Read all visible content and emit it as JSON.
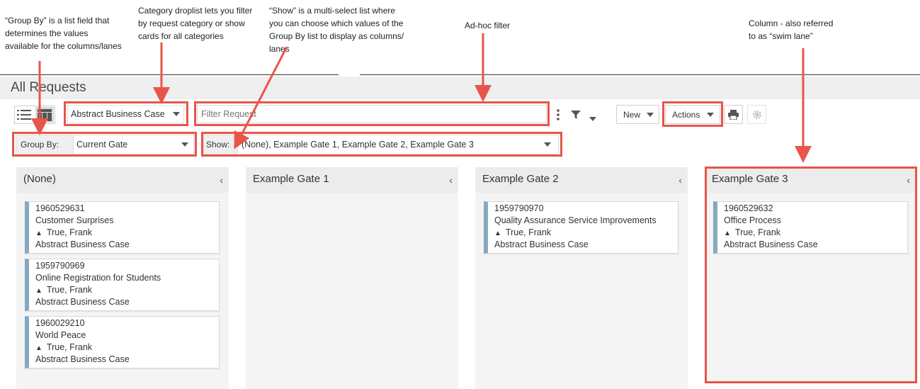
{
  "annotations": {
    "group_by": "“Group By” is a list field that\ndetermines the values\navailable for the columns/lanes",
    "category": "Category droplist lets you filter\nby request category or show\ncards for all categories",
    "show": "“Show” is a multi-select list where\nyou can choose which values of the\nGroup By list to display as columns/\nlanes",
    "adhoc": "Ad-hoc filter",
    "column": "Column - also referred\nto as “swim lane”"
  },
  "page": {
    "title": "All Requests"
  },
  "toolbar": {
    "category_value": "Abstract Business Case",
    "filter_placeholder": "Filter Request",
    "new_label": "New",
    "actions_label": "Actions"
  },
  "controls": {
    "group_by_label": "Group By:",
    "group_by_value": "Current Gate",
    "show_label": "Show:",
    "show_value": "(None), Example Gate 1, Example Gate 2, Example Gate 3"
  },
  "lanes": [
    {
      "title": "(None)",
      "cards": [
        {
          "id": "1960529631",
          "name": "Customer Surprises",
          "owner": "True, Frank",
          "category": "Abstract Business Case"
        },
        {
          "id": "1959790969",
          "name": "Online Registration for Students",
          "owner": "True, Frank",
          "category": "Abstract Business Case"
        },
        {
          "id": "1960029210",
          "name": "World Peace",
          "owner": "True, Frank",
          "category": "Abstract Business Case"
        }
      ]
    },
    {
      "title": "Example Gate 1",
      "cards": []
    },
    {
      "title": "Example Gate 2",
      "cards": [
        {
          "id": "1959790970",
          "name": "Quality Assurance Service Improvements",
          "owner": "True, Frank",
          "category": "Abstract Business Case"
        }
      ]
    },
    {
      "title": "Example Gate 3",
      "cards": [
        {
          "id": "1960529632",
          "name": "Office Process",
          "owner": "True, Frank",
          "category": "Abstract Business Case"
        }
      ]
    }
  ],
  "colors": {
    "highlight": "#e8554b",
    "card_stripe": "#86a9c1"
  }
}
